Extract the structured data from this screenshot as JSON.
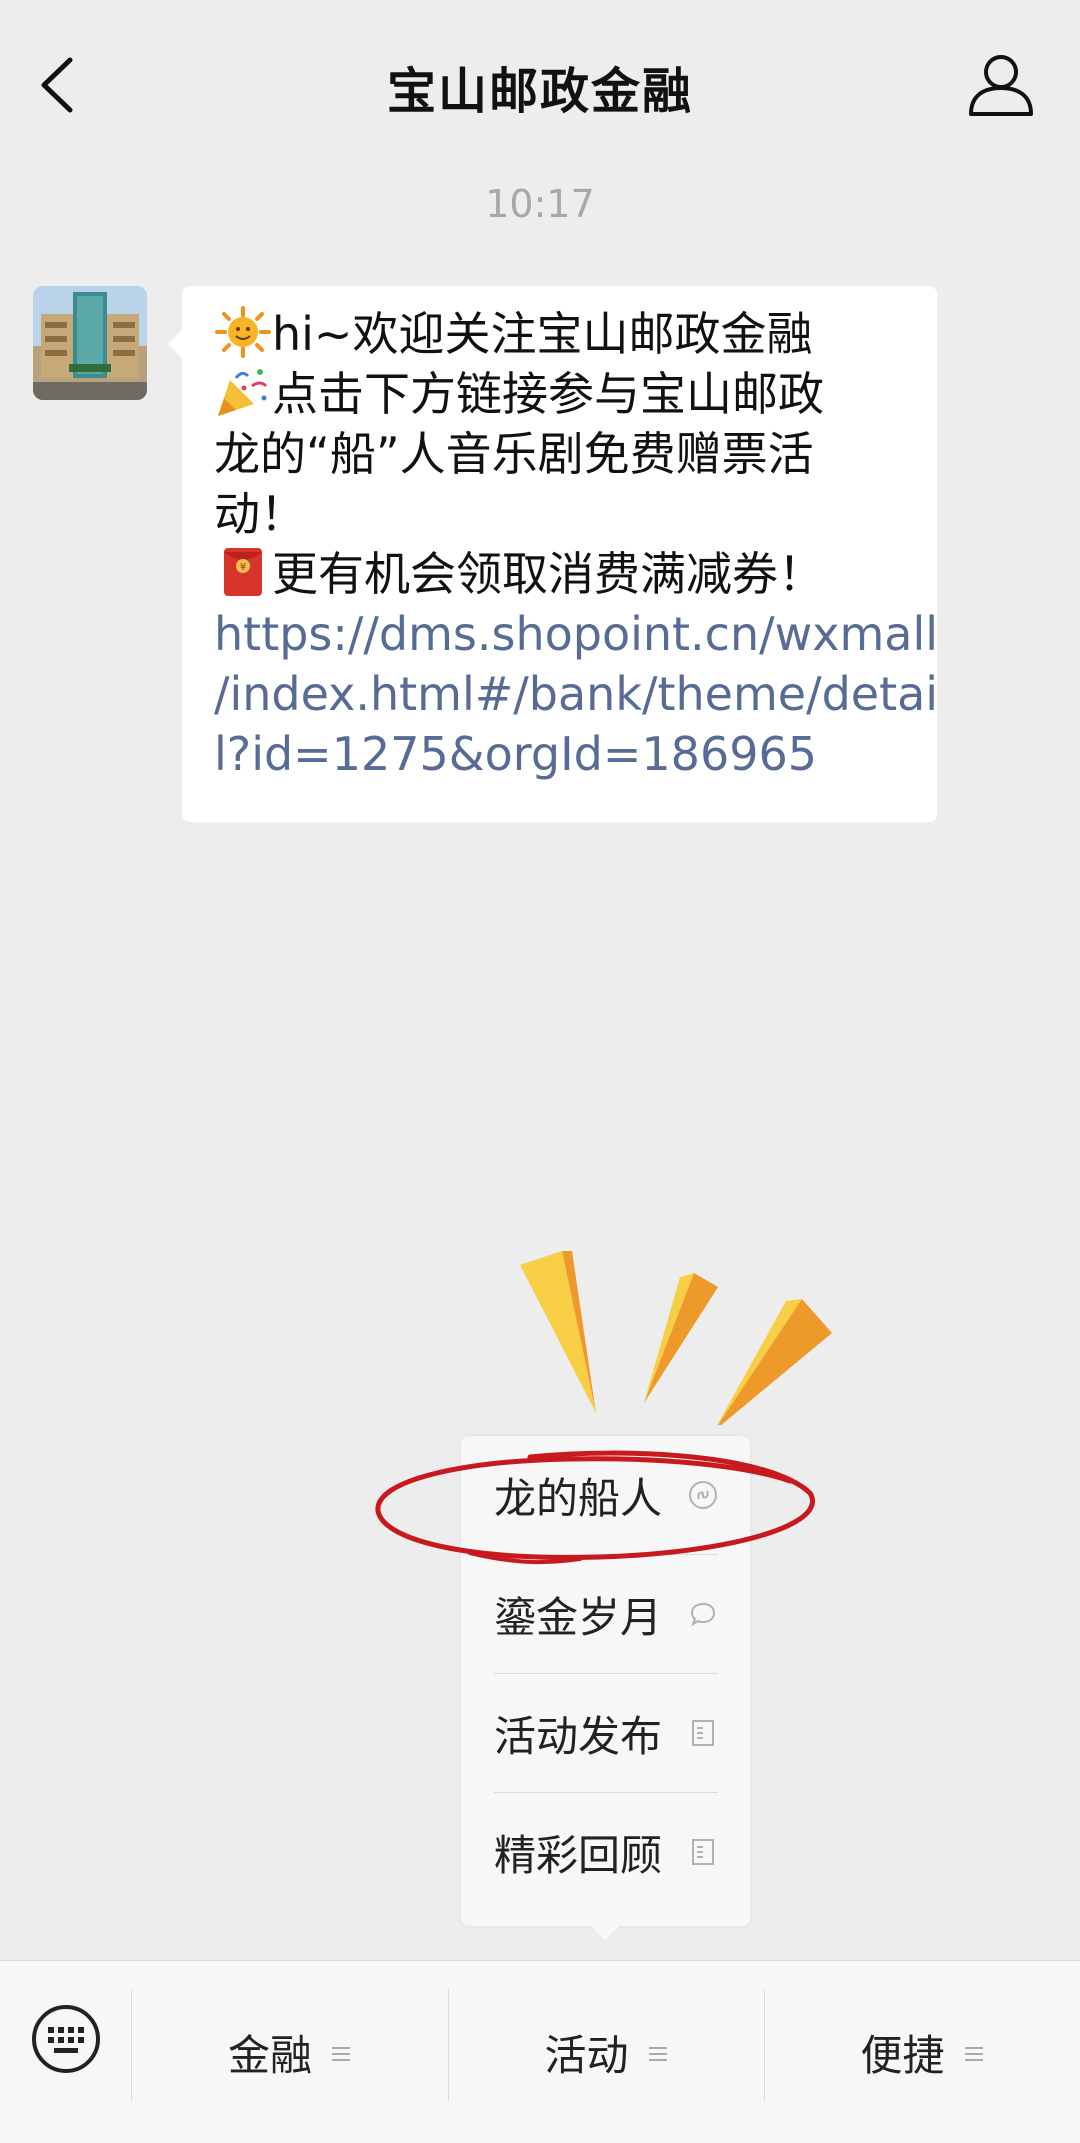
{
  "header": {
    "title": "宝山邮政金融",
    "back_icon": "chevron-left-icon",
    "profile_icon": "person-icon"
  },
  "timestamp": "10:17",
  "message": {
    "avatar": "building-photo-avatar",
    "line1_emoji": "sun-emoji",
    "line1_text": "hi~欢迎关注宝山邮政金融",
    "line2_emoji": "party-popper-emoji",
    "line2_text": "点击下方链接参与宝山邮政",
    "line3_text": "龙的“船”人音乐剧免费赠票活",
    "line4_text": "动！",
    "line5_emoji": "red-envelope-emoji",
    "line5_text": "更有机会领取消费满减券！",
    "link_line1": "https://dms.shopoint.cn/wxmall",
    "link_line2": "/index.html#/bank/theme/detai",
    "link_line3": "l?id=1275&orgId=186965"
  },
  "popup_menu": {
    "items": [
      {
        "label": "龙的船人",
        "icon": "mini-program-icon"
      },
      {
        "label": "鎏金岁月",
        "icon": "chat-bubble-icon"
      },
      {
        "label": "活动发布",
        "icon": "document-icon"
      },
      {
        "label": "精彩回顾",
        "icon": "document-icon"
      }
    ]
  },
  "bottom_bar": {
    "keyboard_icon": "keyboard-icon",
    "tabs": [
      {
        "label": "金融",
        "icon": "menu-lines-icon"
      },
      {
        "label": "活动",
        "icon": "menu-lines-icon"
      },
      {
        "label": "便捷",
        "icon": "menu-lines-icon"
      }
    ]
  },
  "colors": {
    "background": "#ededed",
    "link": "#576b95",
    "highlight_circle": "#c8191e",
    "burst_yellow": "#f8ce45",
    "burst_orange": "#ee9a2a"
  }
}
